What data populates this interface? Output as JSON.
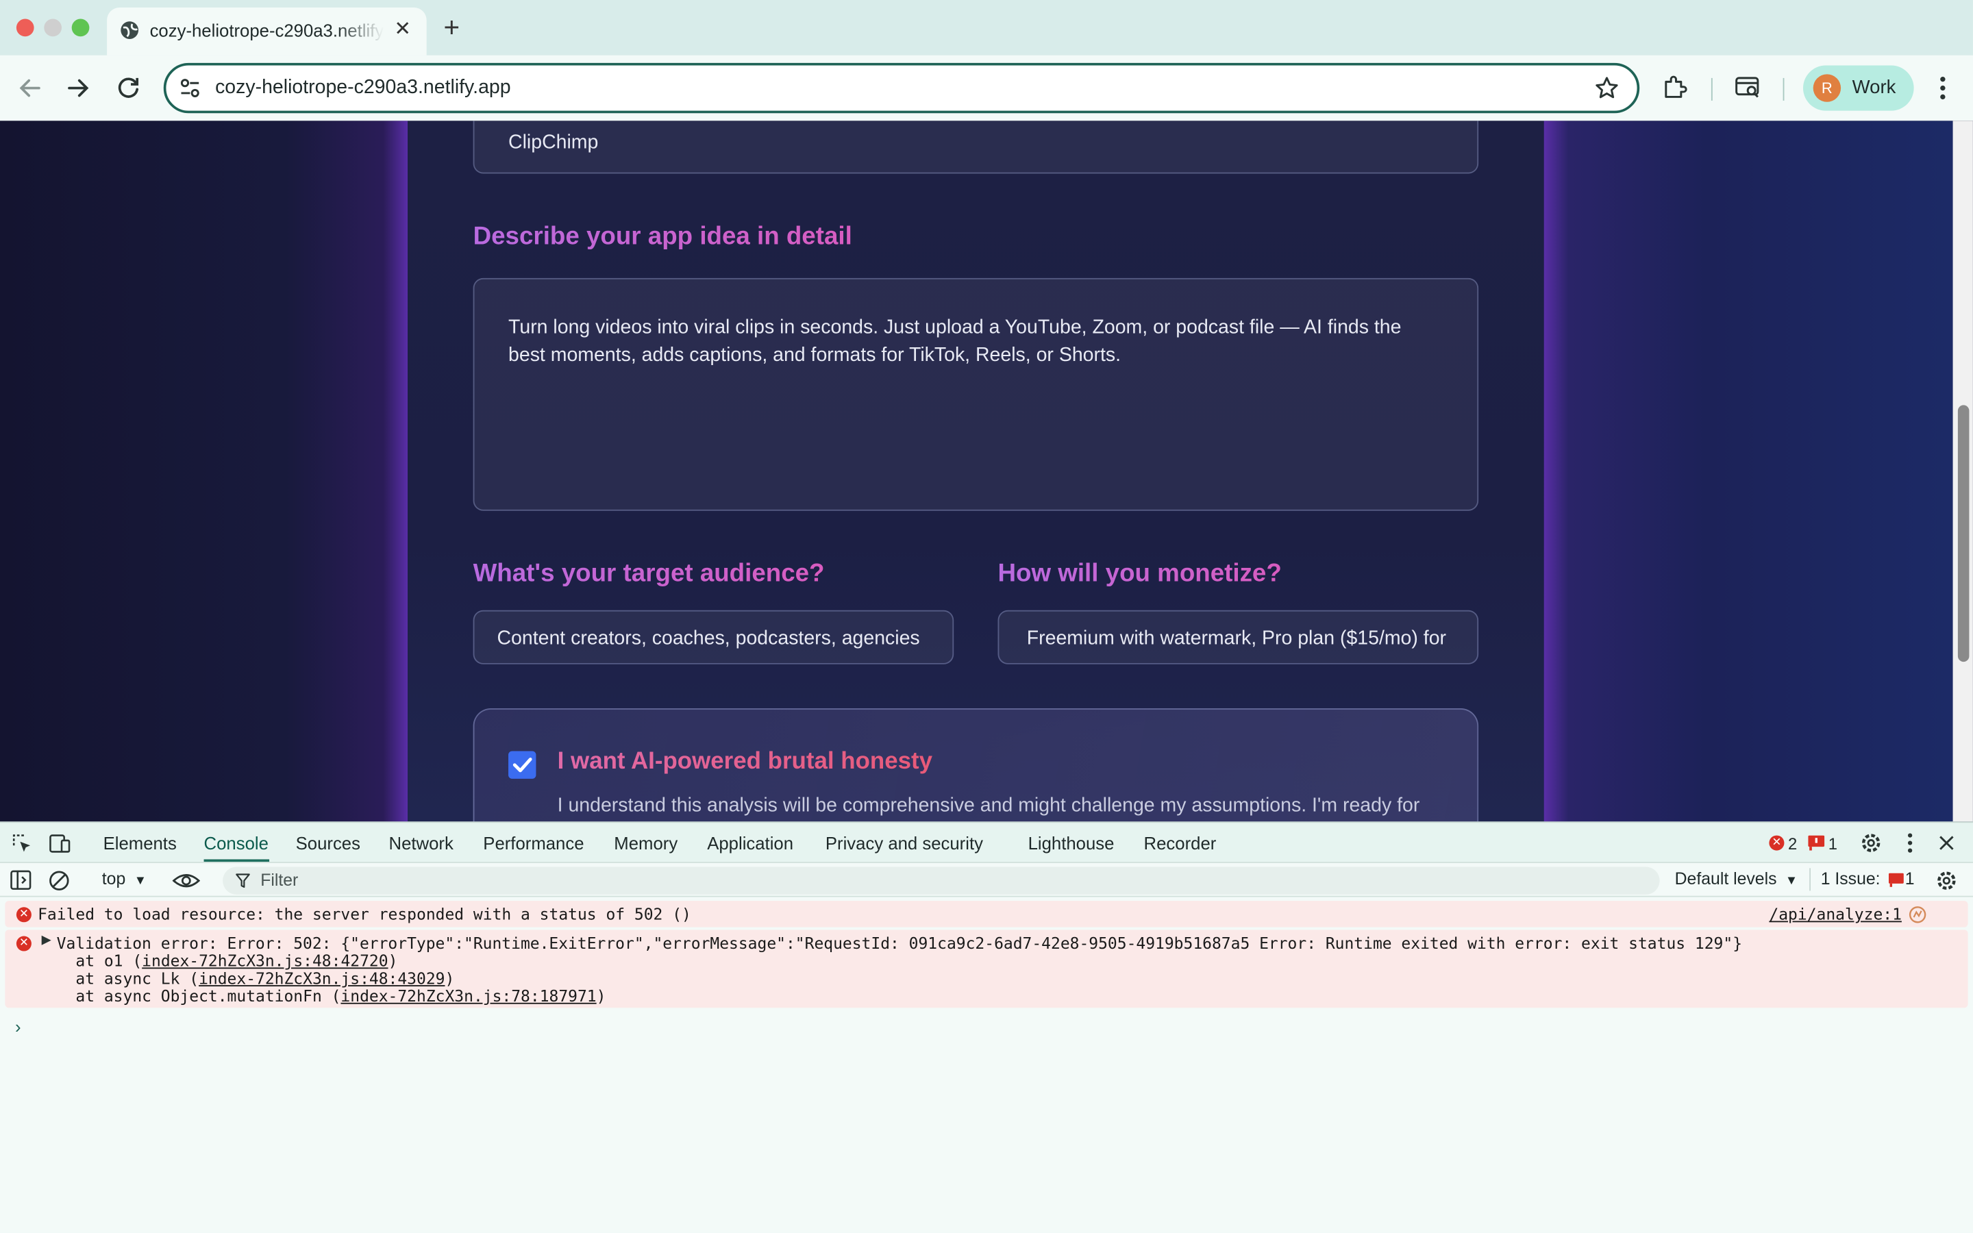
{
  "browser": {
    "tab_title": "cozy-heliotrope-c290a3.netlify.app",
    "url": "cozy-heliotrope-c290a3.netlify.app",
    "profile_initial": "R",
    "profile_label": "Work"
  },
  "page": {
    "app_name_value": "ClipChimp",
    "idea_heading": "Describe your app idea in detail",
    "idea_value": "Turn long videos into viral clips in seconds. Just upload a YouTube, Zoom, or podcast file — AI finds the best moments, adds captions, and formats for TikTok, Reels, or Shorts.",
    "audience_heading": "What's your target audience?",
    "audience_value": "Content creators, coaches, podcasters, agencies",
    "monetize_heading": "How will you monetize?",
    "monetize_value": "Freemium with watermark, Pro plan ($15/mo) for",
    "honesty_title": "I want AI-powered brutal honesty",
    "honesty_text": "I understand this analysis will be comprehensive and might challenge my assumptions. I'm ready for",
    "honesty_checked": true
  },
  "devtools": {
    "tabs": [
      "Elements",
      "Console",
      "Sources",
      "Network",
      "Performance",
      "Memory",
      "Application",
      "Privacy and security",
      "Lighthouse",
      "Recorder"
    ],
    "active_tab": "Console",
    "error_count": "2",
    "issue_count": "1",
    "context": "top",
    "filter_placeholder": "Filter",
    "levels": "Default levels",
    "issues_label": "1 Issue:",
    "issues_badge": "1",
    "messages": [
      {
        "text": "Failed to load resource: the server responded with a status of 502 ()",
        "source": "/api/analyze:1"
      },
      {
        "text": "Validation error: Error: 502: {\"errorType\":\"Runtime.ExitError\",\"errorMessage\":\"RequestId: 091ca9c2-6ad7-42e8-9505-4919b51687a5 Error: Runtime exited with error: exit status 129\"}",
        "stack": [
          {
            "prefix": "    at o1 (",
            "link": "index-72hZcX3n.js:48:42720",
            "suffix": ")"
          },
          {
            "prefix": "    at async Lk (",
            "link": "index-72hZcX3n.js:48:43029",
            "suffix": ")"
          },
          {
            "prefix": "    at async Object.mutationFn (",
            "link": "index-72hZcX3n.js:78:187971",
            "suffix": ")"
          }
        ]
      }
    ],
    "prompt_symbol": "›"
  },
  "colors": {
    "accent": "#1e6356",
    "error": "#d93025",
    "checkbox": "#3b6cf0"
  }
}
